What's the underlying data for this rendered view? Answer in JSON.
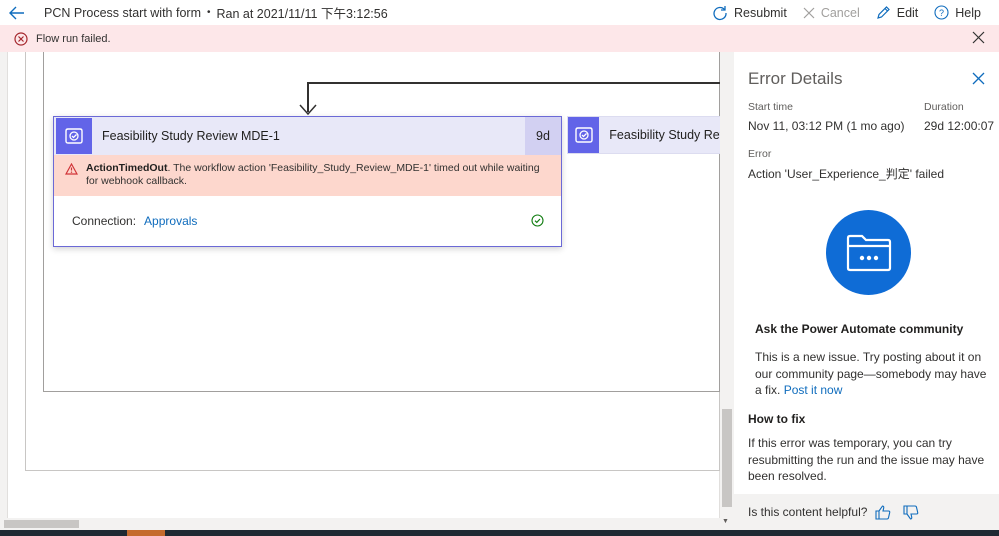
{
  "header": {
    "flow_name": "PCN Process start with form",
    "separator": "•",
    "run_info": "Ran at 2021/11/11 下午3:12:56"
  },
  "commands": {
    "resubmit": "Resubmit",
    "cancel": "Cancel",
    "edit": "Edit",
    "help": "Help"
  },
  "banner": {
    "message": "Flow run failed."
  },
  "action_card": {
    "title": "Feasibility Study Review MDE-1",
    "duration": "9d",
    "error_code": "ActionTimedOut",
    "error_message": ". The workflow action 'Feasibility_Study_Review_MDE-1' timed out while waiting for webhook callback.",
    "connection_label": "Connection:",
    "connection_value": "Approvals"
  },
  "action_card_2": {
    "title": "Feasibility Study Rev"
  },
  "error_panel": {
    "title": "Error Details",
    "start_time_label": "Start time",
    "start_time_value": "Nov 11, 03:12 PM (1 mo ago)",
    "duration_label": "Duration",
    "duration_value": "29d 12:00:07",
    "error_label": "Error",
    "error_value": "Action 'User_Experience_判定' failed",
    "community_title": "Ask the Power Automate community",
    "community_text": "This is a new issue. Try posting about it on our community page—somebody may have a fix.",
    "post_link": "Post it now",
    "fix_title": "How to fix",
    "fix_text": "If this error was temporary, you can try resubmitting the run and the issue may have been resolved.",
    "helpful_question": "Is this content helpful?"
  },
  "colors": {
    "accent": "#0f6cbd",
    "error_banner": "#fde7e9",
    "card_error": "#fdd7cd",
    "action_icon": "#6264e8",
    "community_icon": "#0f6cd6"
  }
}
